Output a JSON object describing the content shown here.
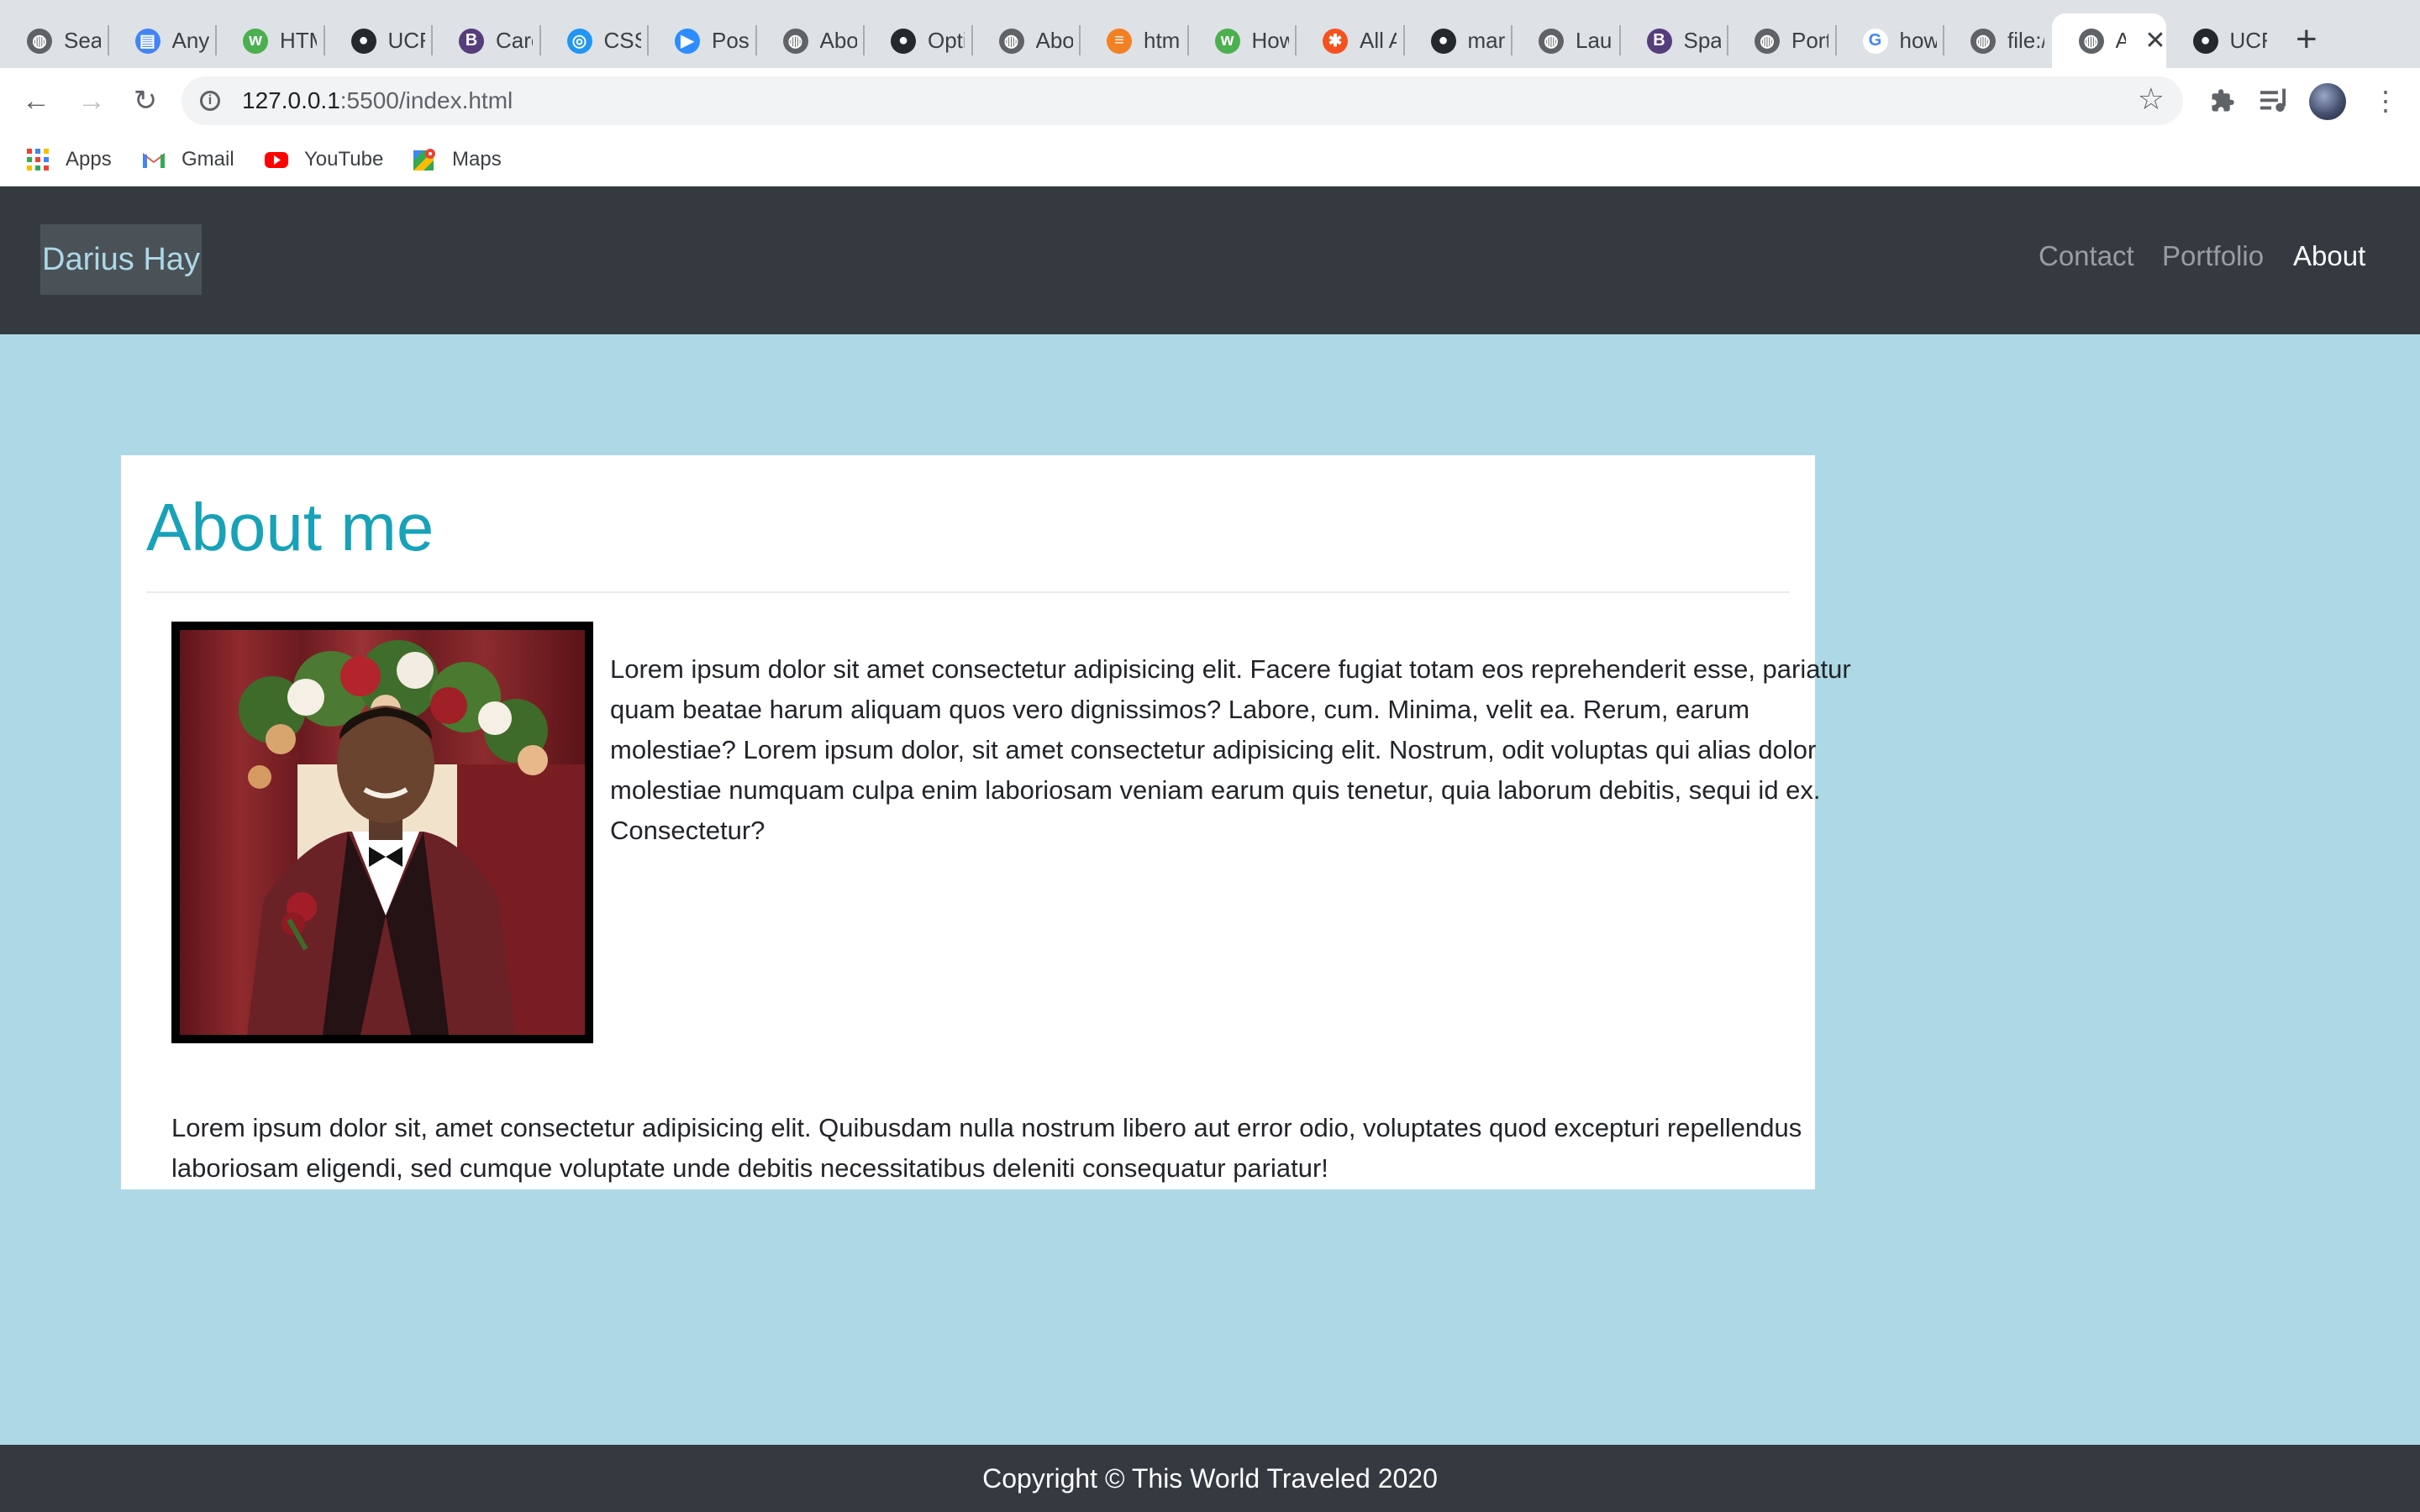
{
  "browser": {
    "tabs": [
      {
        "title": "Sear",
        "icon": "globe-icon",
        "color": "#5f6368"
      },
      {
        "title": "Any",
        "icon": "document-icon",
        "color": "#4285f4"
      },
      {
        "title": "HTM",
        "icon": "w3schools-icon",
        "color": "#4caf50"
      },
      {
        "title": "UCF",
        "icon": "github-icon",
        "color": "#24292e"
      },
      {
        "title": "Carc",
        "icon": "bootstrap-icon",
        "color": "#563d7c"
      },
      {
        "title": "CSS",
        "icon": "css-icon",
        "color": "#2196f3"
      },
      {
        "title": "Post",
        "icon": "zoom-icon",
        "color": "#2d8cff"
      },
      {
        "title": "Abo",
        "icon": "globe-icon",
        "color": "#5f6368"
      },
      {
        "title": "Opti",
        "icon": "github-icon",
        "color": "#24292e"
      },
      {
        "title": "Abo",
        "icon": "globe-icon",
        "color": "#5f6368"
      },
      {
        "title": "html",
        "icon": "stackoverflow-icon",
        "color": "#f48024"
      },
      {
        "title": "How",
        "icon": "w3schools-icon",
        "color": "#4caf50"
      },
      {
        "title": "All A",
        "icon": "asterisk-icon",
        "color": "#f4511e"
      },
      {
        "title": "mari",
        "icon": "github-icon",
        "color": "#24292e"
      },
      {
        "title": "Laur",
        "icon": "globe-icon",
        "color": "#5f6368"
      },
      {
        "title": "Spac",
        "icon": "bootstrap-icon",
        "color": "#563d7c"
      },
      {
        "title": "Port",
        "icon": "globe-icon",
        "color": "#5f6368"
      },
      {
        "title": "how",
        "icon": "google-icon",
        "color": "#4285f4"
      },
      {
        "title": "file:/",
        "icon": "globe-icon",
        "color": "#5f6368"
      },
      {
        "title": "A",
        "icon": "globe-icon",
        "color": "#5f6368",
        "active": true
      },
      {
        "title": "UCF",
        "icon": "github-icon",
        "color": "#24292e"
      }
    ],
    "url_host": "127.0.0.1",
    "url_rest": ":5500/index.html",
    "bookmarks": [
      {
        "label": "Apps",
        "icon": "apps-grid-icon"
      },
      {
        "label": "Gmail",
        "icon": "gmail-icon"
      },
      {
        "label": "YouTube",
        "icon": "youtube-icon"
      },
      {
        "label": "Maps",
        "icon": "maps-icon"
      }
    ]
  },
  "navbar": {
    "brand": "Darius Hay",
    "links": [
      {
        "label": "Contact",
        "active": false
      },
      {
        "label": "Portfolio",
        "active": false
      },
      {
        "label": "About",
        "active": true
      }
    ],
    "background": "#343a40",
    "brand_color": "#add8e6"
  },
  "main": {
    "heading": "About me",
    "heading_color": "#17a2b8",
    "paragraph1": " Lorem ipsum dolor sit amet consectetur adipisicing elit. Facere fugiat totam eos reprehenderit esse, pariatur quam beatae harum aliquam quos vero dignissimos? Labore, cum. Minima, velit ea. Rerum, earum molestiae? Lorem ipsum dolor, sit amet consectetur adipisicing elit. Nostrum, odit voluptas qui alias dolor molestiae numquam culpa enim laboriosam veniam earum quis tenetur, quia laborum debitis, sequi id ex. Consectetur?",
    "paragraph2": "Lorem ipsum dolor sit, amet consectetur adipisicing elit. Quibusdam nulla nostrum libero aut error odio, voluptates quod excepturi repellendus laboriosam eligendi, sed cumque voluptate unde debitis necessitatibus deleniti consequatur pariatur!",
    "page_background": "#add8e6"
  },
  "footer": {
    "text": "Copyright © This World Traveled 2020"
  }
}
